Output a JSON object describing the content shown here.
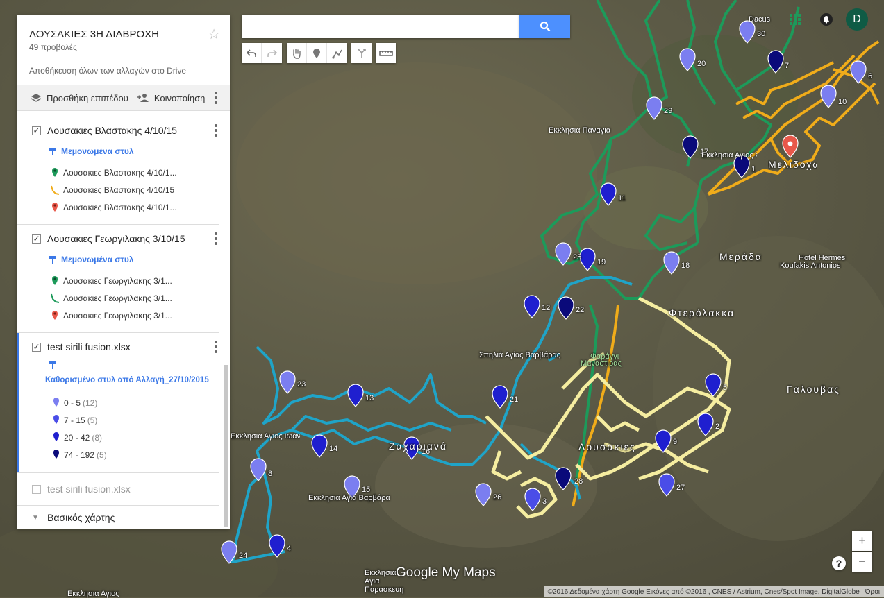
{
  "map": {
    "labels": {
      "ekklisia_panagia": "Εκκλησια Παναγια",
      "ekklisia_agios_fanourios": "Εκκλησια Αγιος Φανουριος",
      "melidochori": "Μελιδοχωρι",
      "merada": "Μεράδα",
      "hotel": "Hotel Hermes",
      "hotel2": "Koufakis Antonios",
      "fterolakka": "Φτερόλακκα",
      "spilia": "Σπηλιά Αγίας Βαρβάρας",
      "faragi": "Φαράγγι",
      "faragi2": "Μαναστιρας",
      "galouvas": "Γαλουβας",
      "lousakies": "Λουσακιες",
      "zachariana": "Ζαχαριανά",
      "agios_ioannis": "Εκκλησια Αγιος Ιωαννης",
      "agia_varvara": "Εκκλησια Αγια Βαρβάρα",
      "paraskevi": "Εκκλησια Αγια Παρασκευη",
      "agios_bottom": "Εκκλησια Αγιος",
      "dacus": "Dacus"
    },
    "pin_labels": [
      "30",
      "7",
      "20",
      "6",
      "10",
      "29",
      "17",
      "1",
      "11",
      "25",
      "19",
      "18",
      "12",
      "22",
      "21",
      "23",
      "13",
      "14",
      "16",
      "8",
      "15",
      "26",
      "3",
      "28",
      "9",
      "27",
      "2",
      "5",
      "24",
      "4"
    ]
  },
  "search": {
    "placeholder": ""
  },
  "panel": {
    "title": "ΛΟΥΣΑΚΙΕΣ 3Η ΔΙΑΒΡΟΧΗ",
    "views": "49 προβολές",
    "saved": "Αποθήκευση όλων των αλλαγών στο Drive",
    "add_layer": "Προσθήκη επιπέδου",
    "share": "Κοινοποίηση",
    "layers": [
      {
        "name": "Λουσακιες Βλαστακης 4/10/15",
        "style": "Μεμονωμένα στυλ",
        "items": [
          "Λουσακιες Βλαστακης 4/10/1...",
          "Λουσακιες Βλαστακης 4/10/15",
          "Λουσακιες Βλαστακης 4/10/1..."
        ]
      },
      {
        "name": "Λουσακιες Γεωργιλακης 3/10/15",
        "style": "Μεμονωμένα στυλ",
        "items": [
          "Λουσακιες Γεωργιλακης 3/1...",
          "Λουσακιες Γεωργιλακης 3/1...",
          "Λουσακιες Γεωργιλακης 3/1..."
        ]
      },
      {
        "name": "test sirili fusion.xlsx",
        "style": "Καθορισμένο στυλ από Αλλαγή_27/10/2015",
        "legend": [
          {
            "range": "0 - 5",
            "count": "(12)",
            "color": "#7b7ef0"
          },
          {
            "range": "7 - 15",
            "count": "(5)",
            "color": "#4a4de8"
          },
          {
            "range": "20 - 42",
            "count": "(8)",
            "color": "#1f1fcf"
          },
          {
            "range": "74 - 192",
            "count": "(5)",
            "color": "#0a0a7a"
          }
        ]
      }
    ],
    "unchecked_layer": "test sirili fusion.xlsx",
    "basemap": "Βασικός χάρτης"
  },
  "brand": {
    "logo": "Google My Maps",
    "avatar": "D"
  },
  "copyright": "©2016 Δεδομένα χάρτη Google Εικόνες από ©2016 , CNES / Astrium, Cnes/Spot Image, DigitalGlobe",
  "terms": "Όροι",
  "zoom": {
    "in": "+",
    "out": "−"
  }
}
